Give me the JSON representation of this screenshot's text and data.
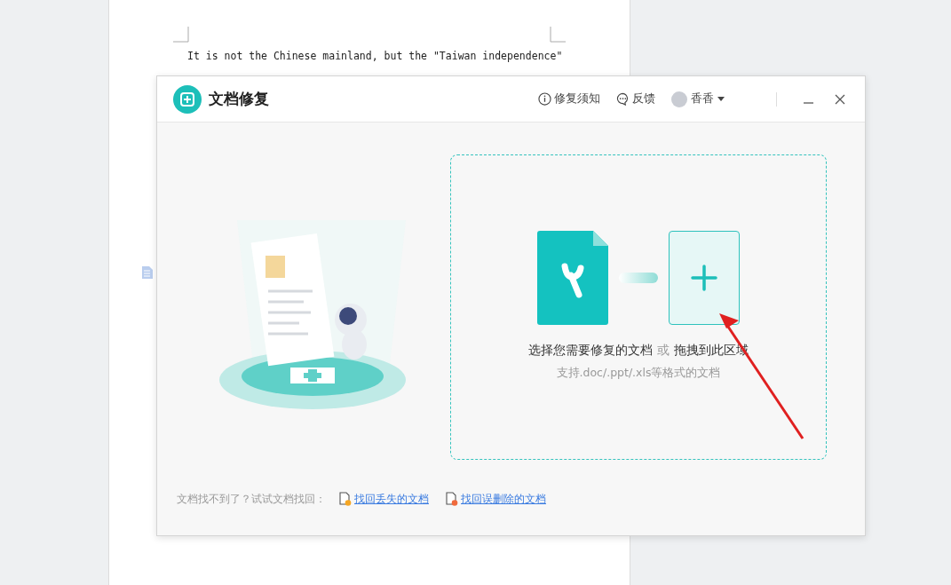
{
  "document": {
    "text": "It is not the Chinese mainland, but the \"Taiwan independence\""
  },
  "dialog": {
    "title": "文档修复",
    "header_links": [
      {
        "label": "修复须知",
        "kind": "info"
      },
      {
        "label": "反馈",
        "kind": "feedback"
      }
    ],
    "user": {
      "name": "香香"
    },
    "drop_zone": {
      "select_label": "选择您需要修复的文档",
      "separator": "或",
      "drag_label": "拖拽到此区域",
      "hint": "支持.doc/.ppt/.xls等格式的文档"
    },
    "footer": {
      "prompt": "文档找不到了？试试文档找回：",
      "links": [
        {
          "label": "找回丢失的文档",
          "kind": "lost"
        },
        {
          "label": "找回误删除的文档",
          "kind": "deleted"
        }
      ]
    }
  }
}
